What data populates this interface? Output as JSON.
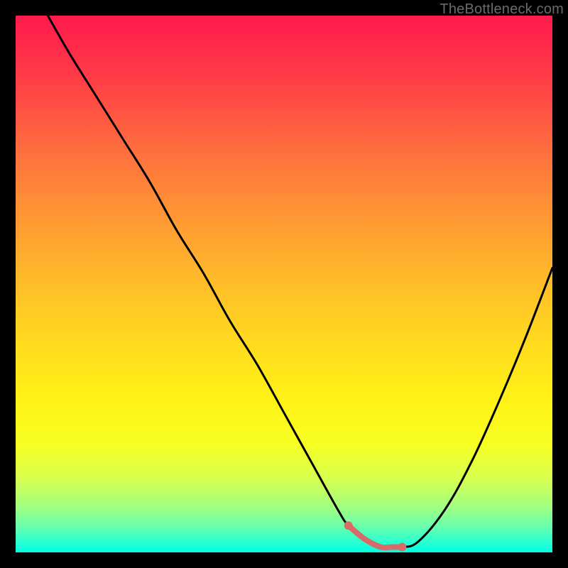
{
  "watermark": "TheBottleneck.com",
  "colors": {
    "page_bg": "#000000",
    "curve_stroke": "#000000",
    "segment_stroke": "#d86a6a",
    "segment_dot_fill": "#d86a6a",
    "watermark_text": "#6b6b6b"
  },
  "chart_data": {
    "type": "line",
    "title": "",
    "xlabel": "",
    "ylabel": "",
    "xlim": [
      0,
      100
    ],
    "ylim": [
      0,
      100
    ],
    "grid": false,
    "annotations": [],
    "series": [
      {
        "name": "bottleneck-curve",
        "x": [
          6,
          10,
          15,
          20,
          25,
          30,
          35,
          40,
          45,
          50,
          55,
          60,
          62,
          65,
          68,
          70,
          72,
          75,
          80,
          85,
          90,
          95,
          100
        ],
        "values": [
          100,
          93,
          85,
          77,
          69,
          60,
          52,
          43,
          35,
          26,
          17,
          8,
          5,
          2.5,
          1,
          1,
          1,
          2,
          8,
          17,
          28,
          40,
          53
        ]
      },
      {
        "name": "optimal-range-segment",
        "x": [
          62,
          65,
          68,
          70,
          72
        ],
        "values": [
          5,
          2.5,
          1,
          1,
          1
        ]
      }
    ],
    "background_gradient_stops": [
      {
        "pos": 0.0,
        "color": "#ff1a4d"
      },
      {
        "pos": 0.14,
        "color": "#ff4545"
      },
      {
        "pos": 0.35,
        "color": "#ff8f36"
      },
      {
        "pos": 0.6,
        "color": "#ffd81f"
      },
      {
        "pos": 0.8,
        "color": "#f7ff23"
      },
      {
        "pos": 0.91,
        "color": "#a8ff7a"
      },
      {
        "pos": 1.0,
        "color": "#00ffe2"
      }
    ]
  }
}
